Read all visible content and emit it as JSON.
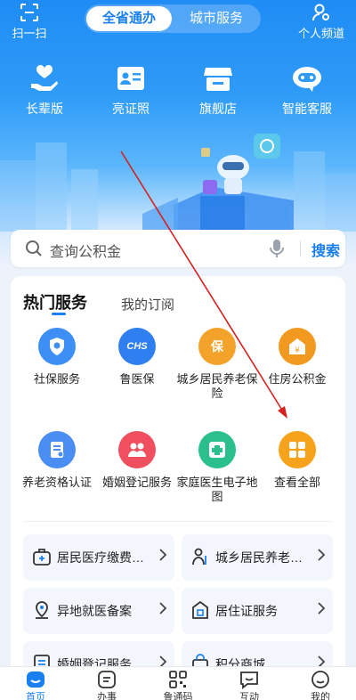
{
  "header": {
    "scan_label": "扫一扫",
    "segment": {
      "active": "全省通办",
      "inactive": "城市服务"
    },
    "personal_label": "个人频道"
  },
  "quick_actions": [
    {
      "label": "长辈版",
      "icon": "heart-hand-icon"
    },
    {
      "label": "亮证照",
      "icon": "id-card-icon"
    },
    {
      "label": "旗舰店",
      "icon": "store-icon"
    },
    {
      "label": "智能客服",
      "icon": "robot-chat-icon"
    }
  ],
  "search": {
    "placeholder": "查询公积金",
    "button": "搜索"
  },
  "services": {
    "tabs": [
      "热门服务",
      "我的订阅"
    ],
    "grid": [
      {
        "label": "社保服务",
        "color": "#3d8ef5",
        "icon": "social-security-icon"
      },
      {
        "label": "鲁医保",
        "color": "#2f7ff0",
        "icon": "medical-insurance-icon",
        "badge": "CHS"
      },
      {
        "label": "城乡居民养老保险",
        "color": "#f3a22a",
        "icon": "pension-icon",
        "badge": "保"
      },
      {
        "label": "住房公积金",
        "color": "#f29a1f",
        "icon": "housing-fund-icon"
      },
      {
        "label": "养老资格认证",
        "color": "#4a8ef3",
        "icon": "certification-icon"
      },
      {
        "label": "婚姻登记服务",
        "color": "#ef4f5f",
        "icon": "marriage-icon"
      },
      {
        "label": "家庭医生电子地图",
        "color": "#2cbf8e",
        "icon": "doctor-map-icon"
      },
      {
        "label": "查看全部",
        "color": "#f7a21b",
        "icon": "grid-icon"
      }
    ],
    "tiles": [
      {
        "label": "居民医疗缴费…",
        "icon": "medical-bag-icon"
      },
      {
        "label": "城乡居民养老…",
        "icon": "elderly-icon"
      },
      {
        "label": "异地就医备案",
        "icon": "location-icon"
      },
      {
        "label": "居住证服务",
        "icon": "residence-icon"
      },
      {
        "label": "婚姻登记服务",
        "icon": "register-icon"
      },
      {
        "label": "积分商城",
        "icon": "shopping-bag-icon"
      }
    ]
  },
  "bottom_nav": [
    {
      "label": "首页",
      "icon": "home-icon",
      "active": true
    },
    {
      "label": "办事",
      "icon": "affairs-icon"
    },
    {
      "label": "鲁通码",
      "icon": "qr-code-icon"
    },
    {
      "label": "互动",
      "icon": "chat-icon"
    },
    {
      "label": "我的",
      "icon": "profile-icon"
    }
  ],
  "colors": {
    "primary": "#1a7ff0",
    "annotation_arrow": "#d62020"
  }
}
